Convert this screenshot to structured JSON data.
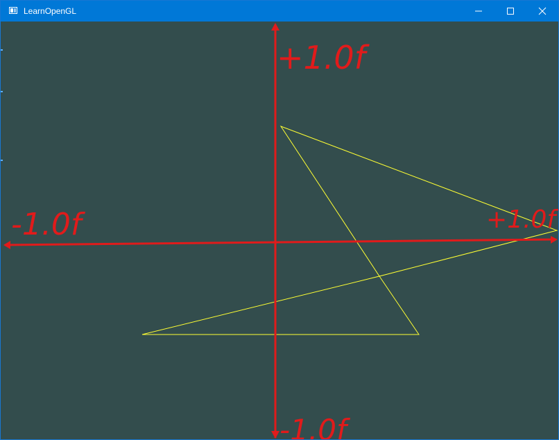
{
  "window": {
    "title": "LearnOpenGL",
    "controls": {
      "minimize": "minimize-icon",
      "maximize": "maximize-icon",
      "close": "close-icon"
    }
  },
  "colors": {
    "titlebar": "#0078d7",
    "clear_color": "#334d4d",
    "triangle": "#ffff33",
    "annotation": "#e11b1b"
  },
  "annotations": {
    "top": "+1.0f",
    "bottom": "-1.0f",
    "left": "-1.0f",
    "right": "+1.0f"
  }
}
